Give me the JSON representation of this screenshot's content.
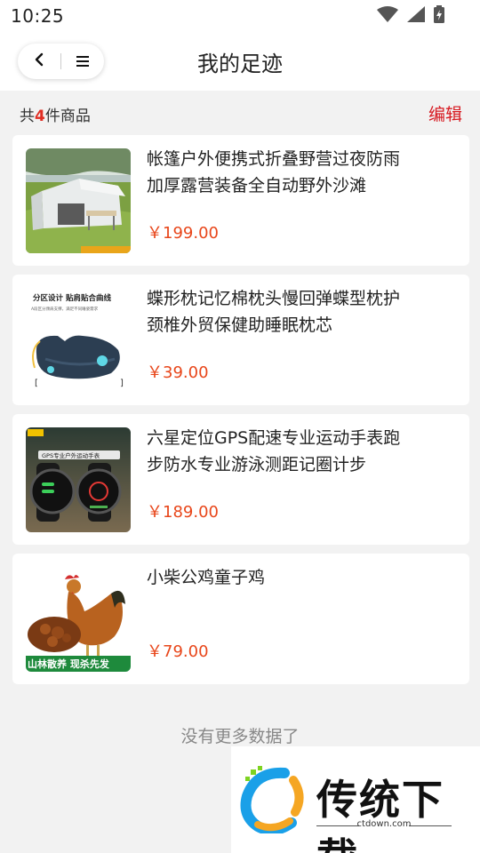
{
  "status_bar": {
    "time": "10:25"
  },
  "header": {
    "title": "我的足迹"
  },
  "summary": {
    "prefix": "共",
    "count": "4",
    "suffix": "件商品",
    "edit_label": "编辑"
  },
  "products": [
    {
      "name": "帐篷户外便携式折叠野营过夜防雨加厚露营装备全自动野外沙滩",
      "price": "￥199.00",
      "image": "camping-tent-photo"
    },
    {
      "name": "蝶形枕记忆棉枕头慢回弹蝶型枕护颈椎外贸保健助睡眠枕芯",
      "price": "￥39.00",
      "image": "butterfly-pillow-photo",
      "image_text": [
        "分区设计 贴肩贴合曲线",
        "A段区分颈肩支撑，满足不同睡姿需求"
      ]
    },
    {
      "name": "六星定位GPS配速专业运动手表跑步防水专业游泳测距记圈计步",
      "price": "￥189.00",
      "image": "gps-sport-watch-photo",
      "image_text": [
        "GPS专业户外运动手表"
      ]
    },
    {
      "name": "小柴公鸡童子鸡",
      "price": "￥79.00",
      "image": "rooster-chicken-photo",
      "image_text": [
        "山林散养 现杀先发"
      ]
    }
  ],
  "footer": {
    "no_more": "没有更多数据了"
  },
  "watermark": {
    "brand": "传统下载",
    "domain": "ctdown.com"
  },
  "colors": {
    "accent_red": "#d71920",
    "price_orange": "#e8461a",
    "background": "#f2f2f2"
  }
}
